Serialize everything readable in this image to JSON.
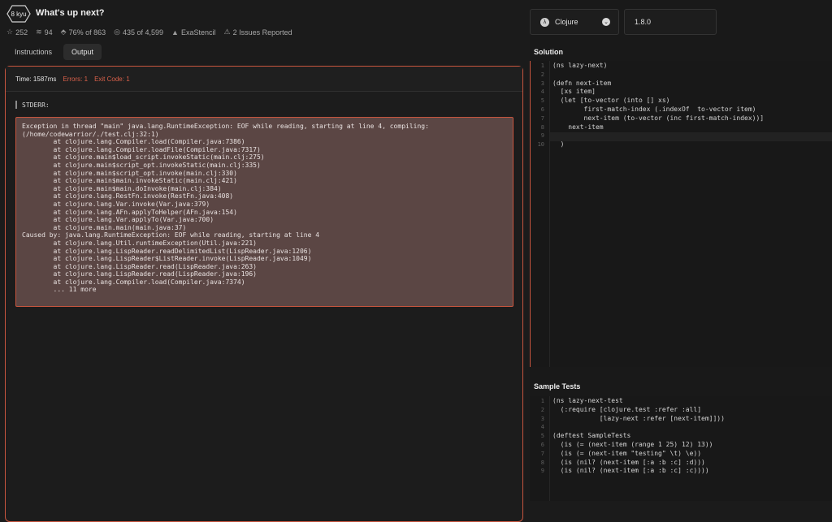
{
  "header": {
    "rank": "8 kyu",
    "title": "What's up next?",
    "stats": {
      "stars": "252",
      "collections": "94",
      "satisfaction": "76% of 863",
      "completed": "435 of 4,599",
      "author": "ExaStencil",
      "issues": "2 Issues Reported"
    }
  },
  "tabs": [
    {
      "label": "Instructions",
      "active": false
    },
    {
      "label": "Output",
      "active": true
    }
  ],
  "output": {
    "time": "Time: 1587ms",
    "errors": "Errors: 1",
    "exit_code": "Exit Code: 1",
    "stderr_label": "STDERR:",
    "stderr_text": "Exception in thread \"main\" java.lang.RuntimeException: EOF while reading, starting at line 4, compiling:\n(/home/codewarrior/./test.clj:32:1)\n        at clojure.lang.Compiler.load(Compiler.java:7386)\n        at clojure.lang.Compiler.loadFile(Compiler.java:7317)\n        at clojure.main$load_script.invokeStatic(main.clj:275)\n        at clojure.main$script_opt.invokeStatic(main.clj:335)\n        at clojure.main$script_opt.invoke(main.clj:330)\n        at clojure.main$main.invokeStatic(main.clj:421)\n        at clojure.main$main.doInvoke(main.clj:384)\n        at clojure.lang.RestFn.invoke(RestFn.java:408)\n        at clojure.lang.Var.invoke(Var.java:379)\n        at clojure.lang.AFn.applyToHelper(AFn.java:154)\n        at clojure.lang.Var.applyTo(Var.java:700)\n        at clojure.main.main(main.java:37)\nCaused by: java.lang.RuntimeException: EOF while reading, starting at line 4\n        at clojure.lang.Util.runtimeException(Util.java:221)\n        at clojure.lang.LispReader.readDelimitedList(LispReader.java:1206)\n        at clojure.lang.LispReader$ListReader.invoke(LispReader.java:1049)\n        at clojure.lang.LispReader.read(LispReader.java:263)\n        at clojure.lang.LispReader.read(LispReader.java:196)\n        at clojure.lang.Compiler.load(Compiler.java:7374)\n        ... 11 more"
  },
  "selectors": {
    "language": "Clojure",
    "version": "1.8.0"
  },
  "solution": {
    "heading": "Solution",
    "line_numbers": [
      "1",
      "2",
      "3",
      "4",
      "5",
      "6",
      "7",
      "8",
      "9",
      "10"
    ],
    "lines": [
      "(ns lazy-next)",
      "",
      "(defn next-item",
      "  [xs item]",
      "  (let [to-vector (into [] xs)",
      "        first-match-index (.indexOf  to-vector item)",
      "        next-item (to-vector (inc first-match-index))]",
      "    next-item",
      "",
      "  )"
    ]
  },
  "sample_tests": {
    "heading": "Sample Tests",
    "line_numbers": [
      "1",
      "2",
      "3",
      "4",
      "5",
      "6",
      "7",
      "8",
      "9"
    ],
    "lines": [
      "(ns lazy-next-test",
      "  (:require [clojure.test :refer :all]",
      "            [lazy-next :refer [next-item]]))",
      "",
      "(deftest SampleTests",
      "  (is (= (next-item (range 1 25) 12) 13))",
      "  (is (= (next-item \"testing\" \\t) \\e))",
      "  (is (nil? (next-item [:a :b :c] :d)))",
      "  (is (nil? (next-item [:a :b :c] :c))))"
    ]
  },
  "colors": {
    "accent": "#c7553e",
    "background": "#1b1b1b",
    "error_box": "#5b4644"
  }
}
